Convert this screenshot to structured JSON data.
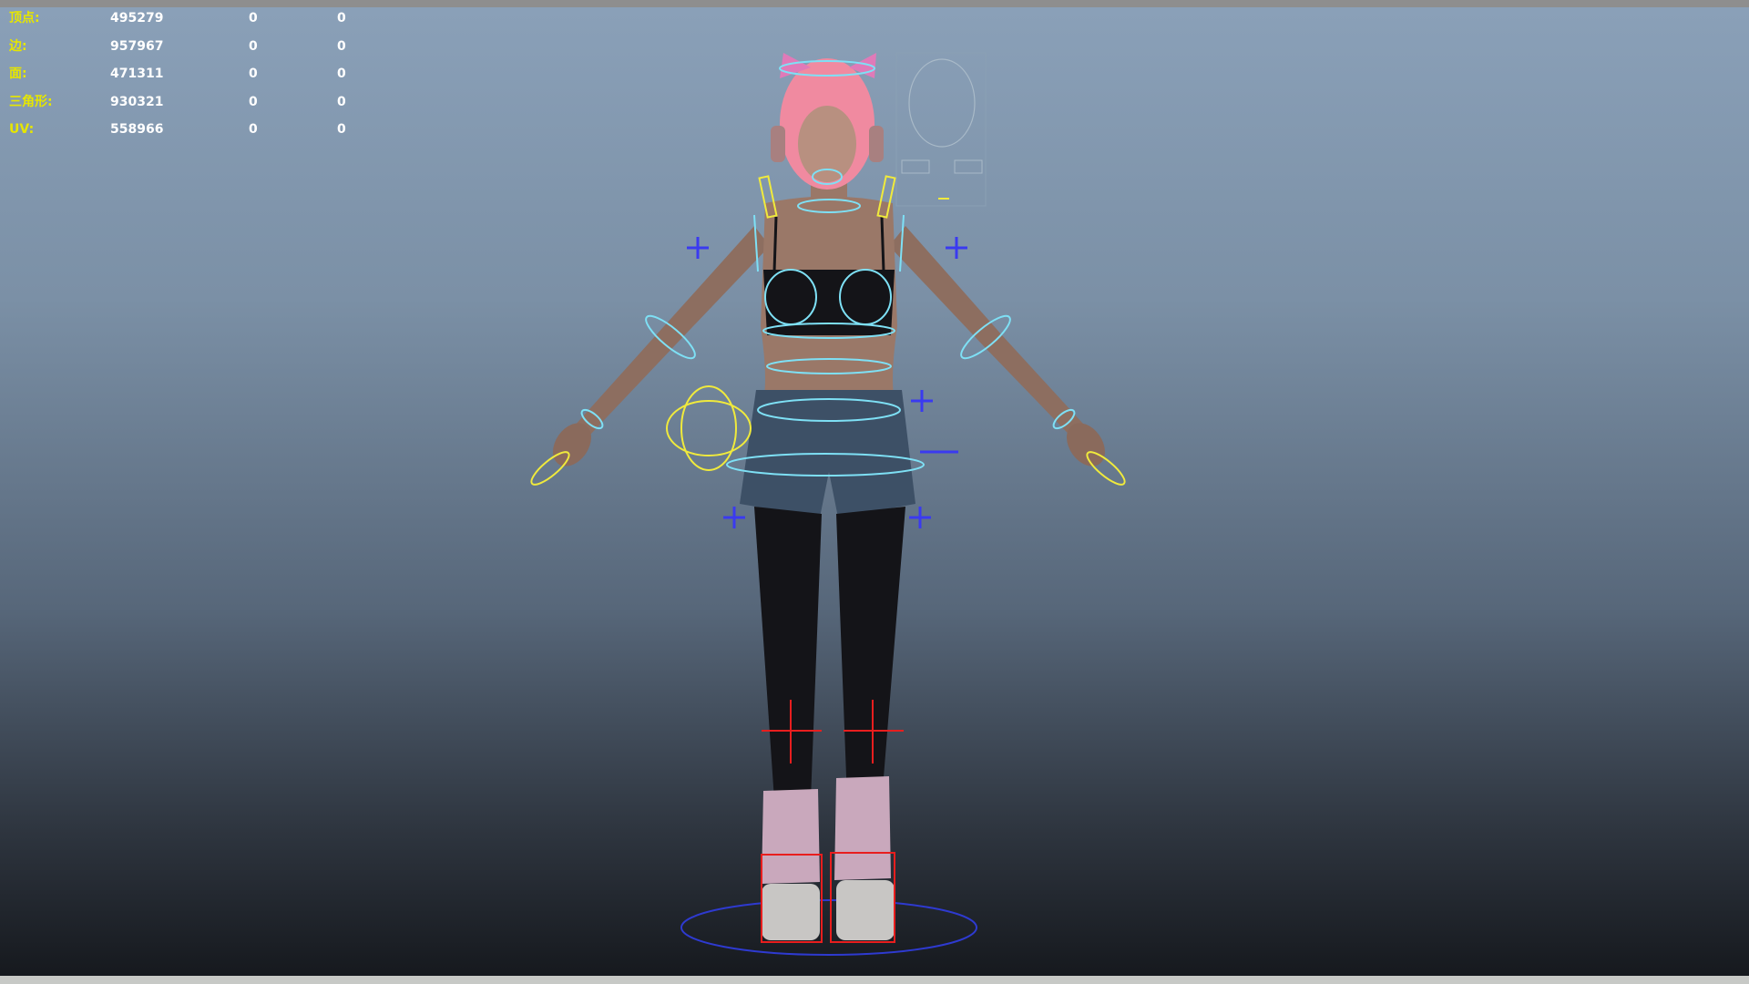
{
  "viewport": {
    "hud_label_color": "#e6e600",
    "hud": [
      {
        "label": "顶点:",
        "value": "495279",
        "col2": "0",
        "col3": "0"
      },
      {
        "label": "边:",
        "value": "957967",
        "col2": "0",
        "col3": "0"
      },
      {
        "label": "面:",
        "value": "471311",
        "col2": "0",
        "col3": "0"
      },
      {
        "label": "三角形:",
        "value": "930321",
        "col2": "0",
        "col3": "0"
      },
      {
        "label": "UV:",
        "value": "558966",
        "col2": "0",
        "col3": "0"
      }
    ]
  },
  "colors": {
    "control_cyan": "#7ee0f5",
    "control_yellow": "#f0ea3c",
    "control_blue": "#3a3af0",
    "control_red": "#e81e1e",
    "hair_pink": "#f08aa0"
  }
}
